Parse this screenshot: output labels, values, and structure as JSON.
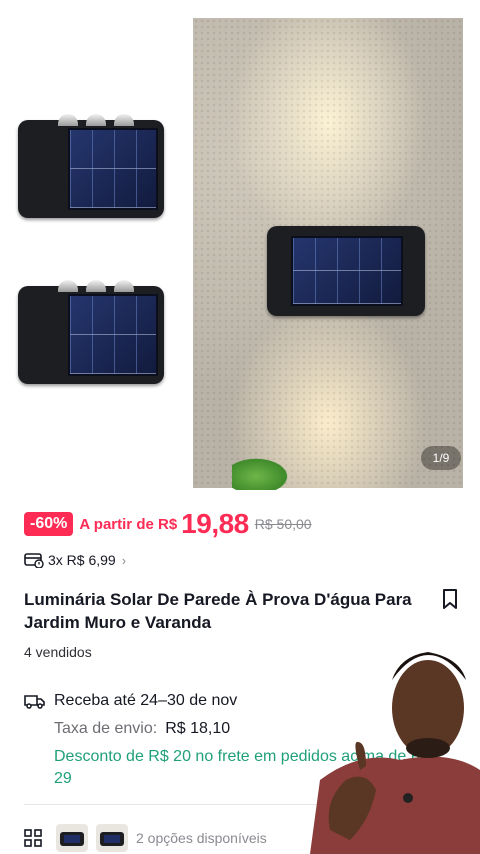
{
  "gallery": {
    "counter": "1/9"
  },
  "pricing": {
    "discount_badge": "-60%",
    "from_label": "A partir de R$",
    "price": "19,88",
    "original_price": "R$ 50,00"
  },
  "installments": {
    "text": "3x R$ 6,99",
    "chevron": "›"
  },
  "product": {
    "title": "Luminária Solar De Parede À Prova D'água Para Jardim Muro e Varanda",
    "sold": "4 vendidos"
  },
  "shipping": {
    "delivery": "Receba até 24–30 de nov",
    "fee_label": "Taxa de envio:",
    "fee_value": "R$ 18,10",
    "promo": "Desconto de R$ 20 no frete em pedidos acima de R$ 29"
  },
  "variants": {
    "summary": "2 opções disponíveis"
  },
  "colors": {
    "accent": "#fe2c55",
    "promo_green": "#20a07a"
  }
}
